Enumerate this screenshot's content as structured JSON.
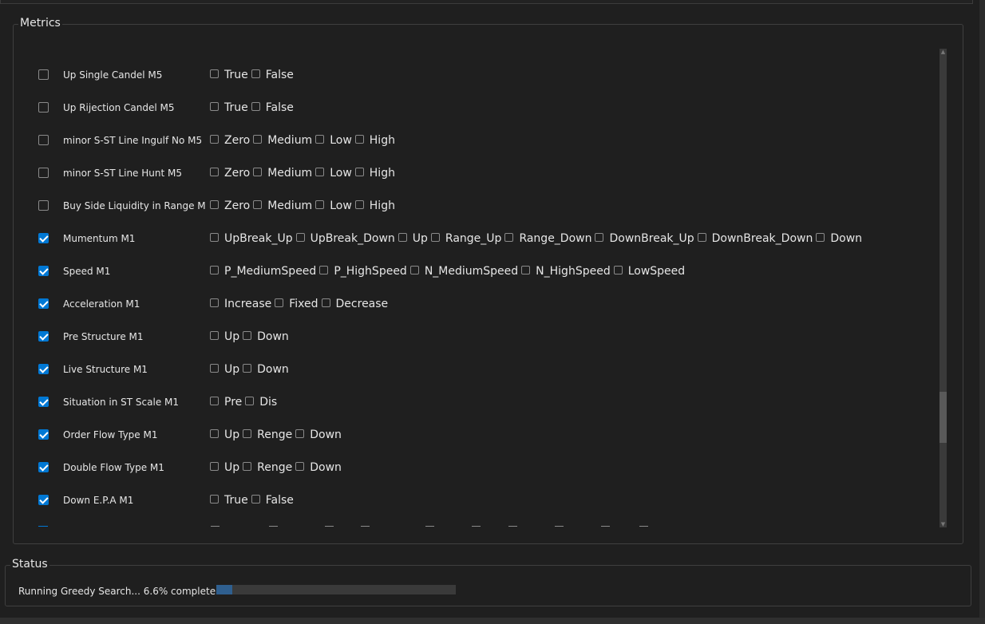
{
  "metrics": {
    "title": "Metrics",
    "rows": [
      {
        "label": "Up Single Candel  M5",
        "checked": false,
        "options": [
          "True",
          "False"
        ]
      },
      {
        "label": "Up Rijection Candel  M5",
        "checked": false,
        "options": [
          "True",
          "False"
        ]
      },
      {
        "label": "minor S-ST Line Ingulf No  M5",
        "checked": false,
        "options": [
          "Zero",
          "Medium",
          "Low",
          "High"
        ]
      },
      {
        "label": "minor S-ST Line Hunt  M5",
        "checked": false,
        "options": [
          "Zero",
          "Medium",
          "Low",
          "High"
        ]
      },
      {
        "label": "Buy Side Liquidity in Range  M",
        "checked": false,
        "options": [
          "Zero",
          "Medium",
          "Low",
          "High"
        ]
      },
      {
        "label": "Mumentum  M1",
        "checked": true,
        "options": [
          "UpBreak_Up",
          "UpBreak_Down",
          "Up",
          "Range_Up",
          "Range_Down",
          "DownBreak_Up",
          "DownBreak_Down",
          "Down"
        ]
      },
      {
        "label": "Speed  M1",
        "checked": true,
        "options": [
          "P_MediumSpeed",
          "P_HighSpeed",
          "N_MediumSpeed",
          "N_HighSpeed",
          "LowSpeed"
        ]
      },
      {
        "label": "Acceleration  M1",
        "checked": true,
        "options": [
          "Increase",
          "Fixed",
          "Decrease"
        ]
      },
      {
        "label": "Pre Structure  M1",
        "checked": true,
        "options": [
          "Up",
          "Down"
        ]
      },
      {
        "label": "Live Structure  M1",
        "checked": true,
        "options": [
          "Up",
          "Down"
        ]
      },
      {
        "label": "Situation in ST Scale  M1",
        "checked": true,
        "options": [
          "Pre",
          "Dis"
        ]
      },
      {
        "label": "Order Flow Type  M1",
        "checked": true,
        "options": [
          "Up",
          "Renge",
          "Down"
        ]
      },
      {
        "label": "Double Flow Type  M1",
        "checked": true,
        "options": [
          "Up",
          "Renge",
          "Down"
        ]
      },
      {
        "label": "Down E.P.A  M1",
        "checked": true,
        "options": [
          "True",
          "False"
        ]
      }
    ]
  },
  "status": {
    "title": "Status",
    "text": "Running Greedy Search... 6.6% complete",
    "progress_fraction": 0.066
  },
  "colors": {
    "accent": "#0078d4",
    "background": "#1f1f1f",
    "progress_fill": "#2f5f8f"
  },
  "icons": {
    "scroll_up": "chevron-up-icon",
    "scroll_down": "chevron-down-icon",
    "check": "check-icon"
  }
}
